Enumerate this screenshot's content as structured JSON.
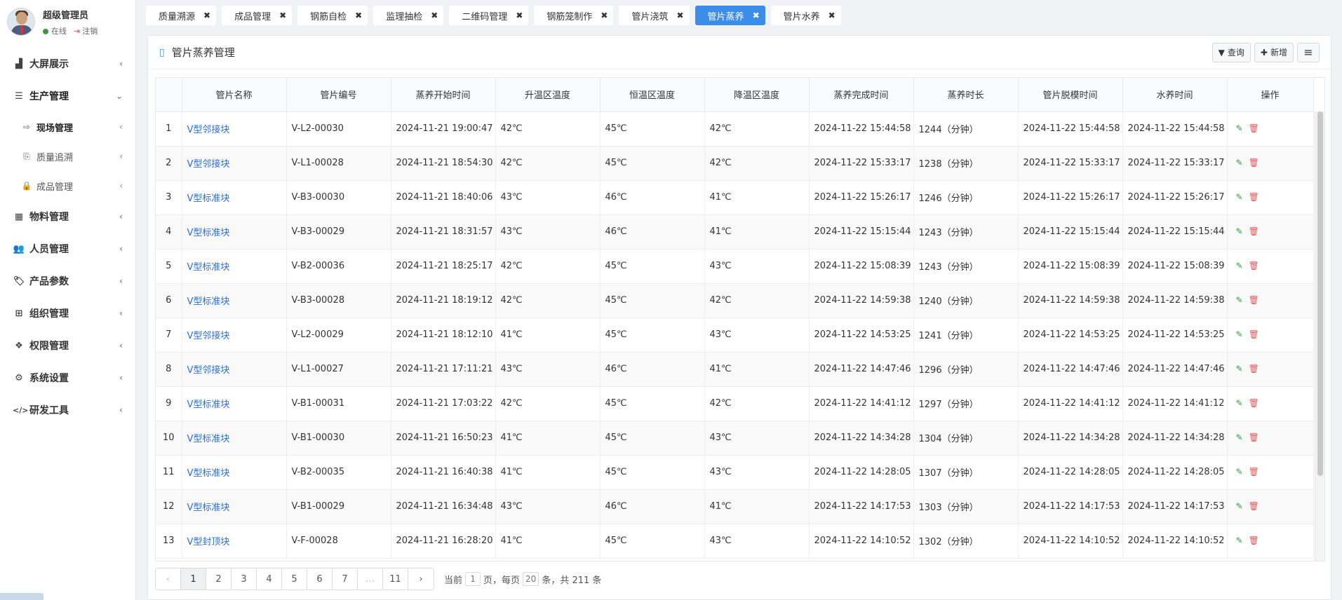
{
  "user": {
    "name": "超级管理员",
    "status_online": "在线",
    "logout": "注销"
  },
  "sidebar": {
    "items": [
      {
        "icon": "chart-area-icon",
        "glyph": "▟",
        "label": "大屏展示",
        "arrow": "‹"
      },
      {
        "icon": "sliders-icon",
        "glyph": "☰",
        "label": "生产管理",
        "arrow": "⌄",
        "open": true
      },
      {
        "icon": "box-icon",
        "glyph": "▦",
        "label": "物料管理",
        "arrow": "‹"
      },
      {
        "icon": "users-icon",
        "glyph": "👥",
        "label": "人员管理",
        "arrow": "‹"
      },
      {
        "icon": "tags-icon",
        "glyph": "🏷",
        "label": "产品参数",
        "arrow": "‹"
      },
      {
        "icon": "grid-icon",
        "glyph": "⊞",
        "label": "组织管理",
        "arrow": "‹"
      },
      {
        "icon": "cubes-icon",
        "glyph": "❖",
        "label": "权限管理",
        "arrow": "‹"
      },
      {
        "icon": "gear-icon",
        "glyph": "⚙",
        "label": "系统设置",
        "arrow": "‹"
      },
      {
        "icon": "code-icon",
        "glyph": "</>",
        "label": "研发工具",
        "arrow": "‹"
      }
    ],
    "sub_items": [
      {
        "icon": "arrow-right-icon",
        "glyph": "⇨",
        "label": "现场管理",
        "arrow": "‹",
        "active": true
      },
      {
        "icon": "sign-in-icon",
        "glyph": "⎘",
        "label": "质量追溯",
        "arrow": "‹"
      },
      {
        "icon": "lock-icon",
        "glyph": "🔒",
        "label": "成品管理",
        "arrow": "‹"
      }
    ]
  },
  "tabs": [
    {
      "label": "质量溯源",
      "close": "✖"
    },
    {
      "label": "成品管理",
      "close": "✖"
    },
    {
      "label": "钢筋自检",
      "close": "✖"
    },
    {
      "label": "监理抽检",
      "close": "✖"
    },
    {
      "label": "二维码管理",
      "close": "✖"
    },
    {
      "label": "钢筋笼制作",
      "close": "✖"
    },
    {
      "label": "管片浇筑",
      "close": "✖"
    },
    {
      "label": "管片蒸养",
      "close": "✖",
      "active": true
    },
    {
      "label": "管片水养",
      "close": "✖"
    }
  ],
  "panel": {
    "title": "管片蒸养管理",
    "query_label": "查询",
    "add_label": "新增",
    "menu_glyph": "≡"
  },
  "table": {
    "columns": [
      "",
      "管片名称",
      "管片编号",
      "蒸养开始时间",
      "升温区温度",
      "恒温区温度",
      "降温区温度",
      "蒸养完成时间",
      "蒸养时长",
      "管片脱模时间",
      "水养时间",
      "操作"
    ],
    "rows": [
      [
        "1",
        "V型邻接块",
        "V-L2-00030",
        "2024-11-21 19:00:47",
        "42℃",
        "45℃",
        "42℃",
        "2024-11-22 15:44:58",
        "1244（分钟）",
        "2024-11-22 15:44:58",
        "2024-11-22 15:44:58"
      ],
      [
        "2",
        "V型邻接块",
        "V-L1-00028",
        "2024-11-21 18:54:30",
        "42℃",
        "45℃",
        "42℃",
        "2024-11-22 15:33:17",
        "1238（分钟）",
        "2024-11-22 15:33:17",
        "2024-11-22 15:33:17"
      ],
      [
        "3",
        "V型标准块",
        "V-B3-00030",
        "2024-11-21 18:40:06",
        "43℃",
        "46℃",
        "41℃",
        "2024-11-22 15:26:17",
        "1246（分钟）",
        "2024-11-22 15:26:17",
        "2024-11-22 15:26:17"
      ],
      [
        "4",
        "V型标准块",
        "V-B3-00029",
        "2024-11-21 18:31:57",
        "43℃",
        "46℃",
        "41℃",
        "2024-11-22 15:15:44",
        "1243（分钟）",
        "2024-11-22 15:15:44",
        "2024-11-22 15:15:44"
      ],
      [
        "5",
        "V型标准块",
        "V-B2-00036",
        "2024-11-21 18:25:17",
        "42℃",
        "45℃",
        "43℃",
        "2024-11-22 15:08:39",
        "1243（分钟）",
        "2024-11-22 15:08:39",
        "2024-11-22 15:08:39"
      ],
      [
        "6",
        "V型标准块",
        "V-B3-00028",
        "2024-11-21 18:19:12",
        "42℃",
        "45℃",
        "42℃",
        "2024-11-22 14:59:38",
        "1240（分钟）",
        "2024-11-22 14:59:38",
        "2024-11-22 14:59:38"
      ],
      [
        "7",
        "V型邻接块",
        "V-L2-00029",
        "2024-11-21 18:12:10",
        "41℃",
        "45℃",
        "43℃",
        "2024-11-22 14:53:25",
        "1241（分钟）",
        "2024-11-22 14:53:25",
        "2024-11-22 14:53:25"
      ],
      [
        "8",
        "V型邻接块",
        "V-L1-00027",
        "2024-11-21 17:11:21",
        "43℃",
        "46℃",
        "41℃",
        "2024-11-22 14:47:46",
        "1296（分钟）",
        "2024-11-22 14:47:46",
        "2024-11-22 14:47:46"
      ],
      [
        "9",
        "V型标准块",
        "V-B1-00031",
        "2024-11-21 17:03:22",
        "42℃",
        "45℃",
        "42℃",
        "2024-11-22 14:41:12",
        "1297（分钟）",
        "2024-11-22 14:41:12",
        "2024-11-22 14:41:12"
      ],
      [
        "10",
        "V型标准块",
        "V-B1-00030",
        "2024-11-21 16:50:23",
        "41℃",
        "45℃",
        "43℃",
        "2024-11-22 14:34:28",
        "1304（分钟）",
        "2024-11-22 14:34:28",
        "2024-11-22 14:34:28"
      ],
      [
        "11",
        "V型标准块",
        "V-B2-00035",
        "2024-11-21 16:40:38",
        "41℃",
        "45℃",
        "43℃",
        "2024-11-22 14:28:05",
        "1307（分钟）",
        "2024-11-22 14:28:05",
        "2024-11-22 14:28:05"
      ],
      [
        "12",
        "V型标准块",
        "V-B1-00029",
        "2024-11-21 16:34:48",
        "43℃",
        "46℃",
        "41℃",
        "2024-11-22 14:17:53",
        "1303（分钟）",
        "2024-11-22 14:17:53",
        "2024-11-22 14:17:53"
      ],
      [
        "13",
        "V型封顶块",
        "V-F-00028",
        "2024-11-21 16:28:20",
        "41℃",
        "45℃",
        "43℃",
        "2024-11-22 14:10:52",
        "1302（分钟）",
        "2024-11-22 14:10:52",
        "2024-11-22 14:10:52"
      ]
    ],
    "edit_glyph": "✎",
    "delete_glyph": "🗑"
  },
  "pagination": {
    "prev": "‹",
    "next": "›",
    "pages": [
      "1",
      "2",
      "3",
      "4",
      "5",
      "6",
      "7",
      "...",
      "11"
    ],
    "current": "1",
    "info_prefix": "当前",
    "info_page_suffix": "页，每页",
    "page_size": "20",
    "info_size_suffix": "条，共 211 条"
  }
}
